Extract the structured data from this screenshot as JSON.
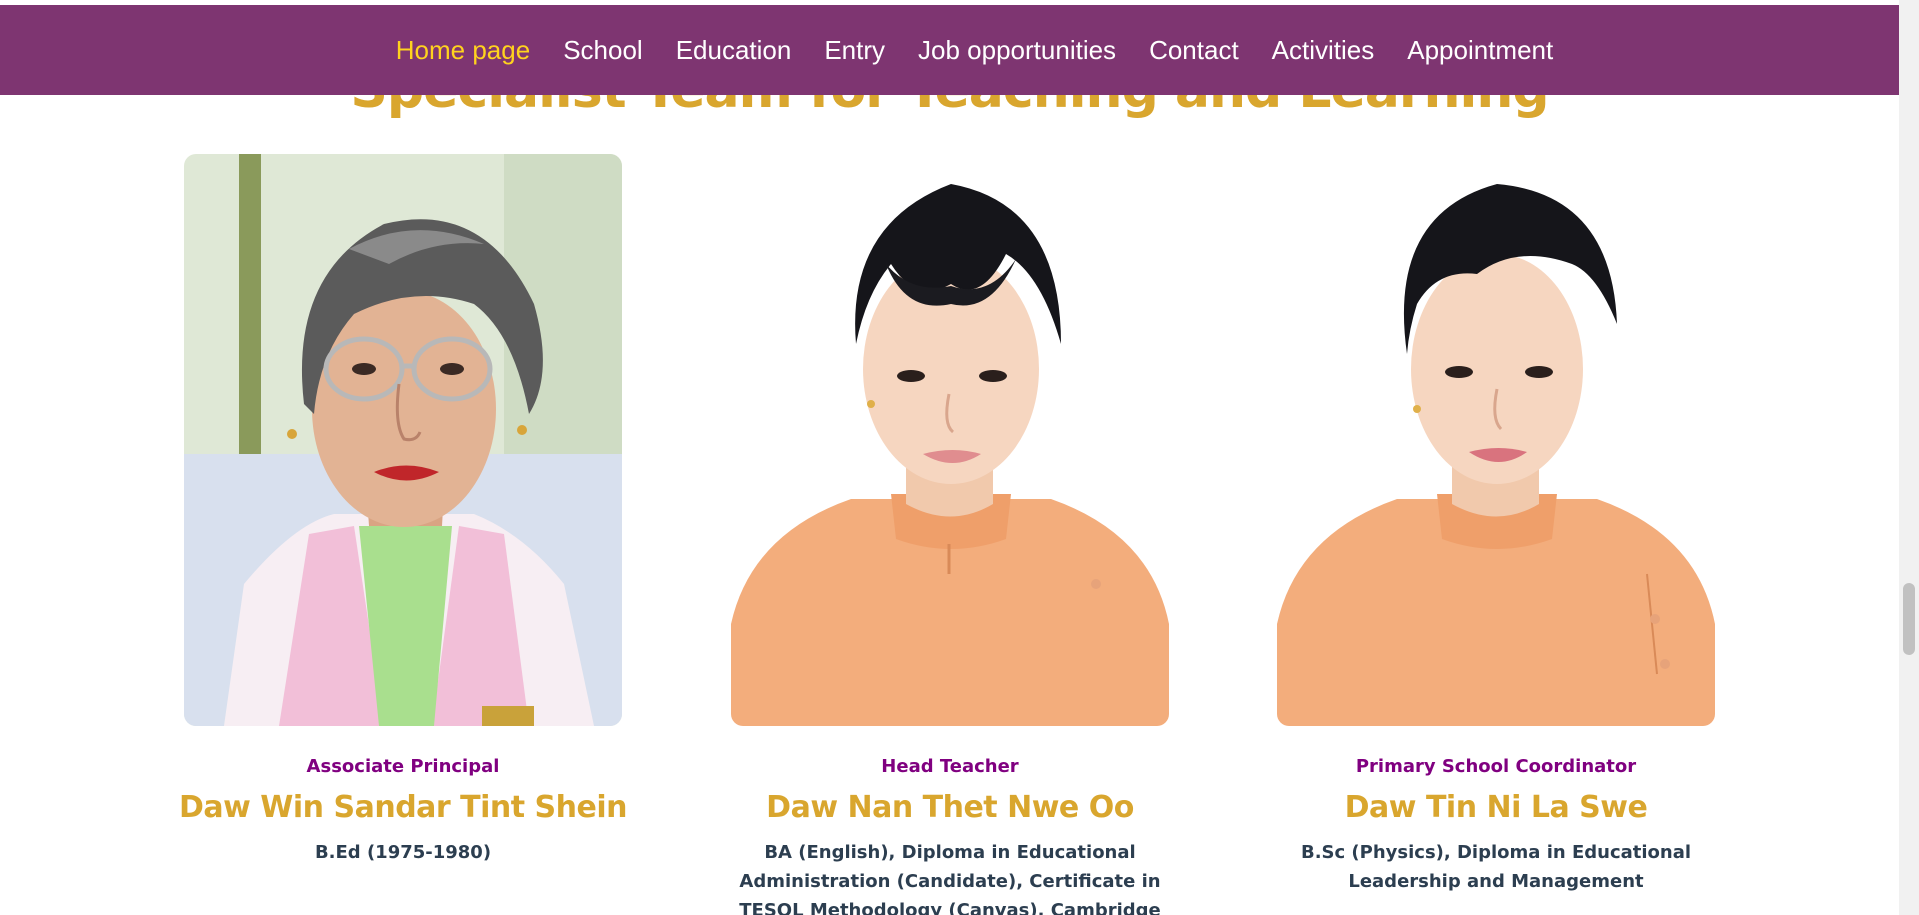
{
  "nav": {
    "items": [
      {
        "label": "Home page",
        "active": true
      },
      {
        "label": "School",
        "active": false
      },
      {
        "label": "Education",
        "active": false
      },
      {
        "label": "Entry",
        "active": false
      },
      {
        "label": "Job opportunities",
        "active": false
      },
      {
        "label": "Contact",
        "active": false
      },
      {
        "label": "Activities",
        "active": false
      },
      {
        "label": "Appointment",
        "active": false
      }
    ]
  },
  "section": {
    "title": "Specialist Team for Teaching and Learning"
  },
  "team": [
    {
      "role": "Associate Principal",
      "name": "Daw Win Sandar Tint Shein",
      "qualifications": "B.Ed (1975-1980)"
    },
    {
      "role": "Head Teacher",
      "name": "Daw Nan Thet Nwe Oo",
      "qualifications": "BA (English), Diploma in Educational Administration (Candidate), Certificate in TESOL Methodology (Canvas), Cambridge English Diploma in Teaching"
    },
    {
      "role": "Primary School Coordinator",
      "name": "Daw Tin Ni La Swe",
      "qualifications": "B.Sc (Physics), Diploma in Educational Leadership and Management"
    }
  ],
  "colors": {
    "nav_bg": "#7e3571",
    "nav_active": "#ffd21e",
    "accent_gold": "#d9a62e",
    "role_purple": "#800080",
    "text_dark": "#2c3e50"
  }
}
